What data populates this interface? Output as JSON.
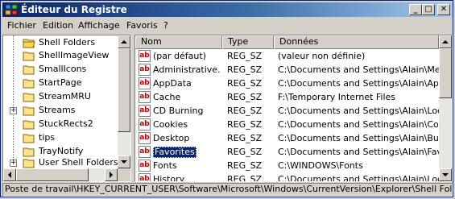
{
  "window": {
    "title": "Éditeur du Registre",
    "minimize_label": "_",
    "maximize_label": "□",
    "close_label": "✕"
  },
  "menu": [
    "Fichier",
    "Edition",
    "Affichage",
    "Favoris",
    "?"
  ],
  "tree": {
    "items": [
      {
        "label": "Shell Folders",
        "expander": ""
      },
      {
        "label": "ShellImageView",
        "expander": ""
      },
      {
        "label": "SmallIcons",
        "expander": ""
      },
      {
        "label": "StartPage",
        "expander": ""
      },
      {
        "label": "StreamMRU",
        "expander": ""
      },
      {
        "label": "Streams",
        "expander": "+"
      },
      {
        "label": "StuckRects2",
        "expander": ""
      },
      {
        "label": "tips",
        "expander": ""
      },
      {
        "label": "TrayNotify",
        "expander": ""
      },
      {
        "label": "User Shell Folders",
        "expander": "+"
      }
    ]
  },
  "list": {
    "columns": [
      "Nom",
      "Type",
      "Données"
    ],
    "rows": [
      {
        "name": "(par défaut)",
        "type": "REG_SZ",
        "data": "(valeur non définie)",
        "selected": false
      },
      {
        "name": "Administrative...",
        "type": "REG_SZ",
        "data": "C:\\Documents and Settings\\Alain\\Me...",
        "selected": false
      },
      {
        "name": "AppData",
        "type": "REG_SZ",
        "data": "C:\\Documents and Settings\\Alain\\App...",
        "selected": false
      },
      {
        "name": "Cache",
        "type": "REG_SZ",
        "data": "F:\\Temporary Internet Files",
        "selected": false
      },
      {
        "name": "CD Burning",
        "type": "REG_SZ",
        "data": "C:\\Documents and Settings\\Alain\\Loc...",
        "selected": false
      },
      {
        "name": "Cookies",
        "type": "REG_SZ",
        "data": "C:\\Documents and Settings\\Alain\\Coo...",
        "selected": false
      },
      {
        "name": "Desktop",
        "type": "REG_SZ",
        "data": "C:\\Documents and Settings\\Alain\\Bur...",
        "selected": false
      },
      {
        "name": "Favorites",
        "type": "REG_SZ",
        "data": "C:\\Documents and Settings\\Alain\\Fav...",
        "selected": true
      },
      {
        "name": "Fonts",
        "type": "REG_SZ",
        "data": "C:\\WINDOWS\\Fonts",
        "selected": false
      },
      {
        "name": "History",
        "type": "REG_SZ",
        "data": "C:\\Documents and Settings\\Alain\\Loc...",
        "selected": false
      }
    ],
    "icon_text": "ab"
  },
  "status": "Poste de travail\\HKEY_CURRENT_USER\\Software\\Microsoft\\Windows\\CurrentVersion\\Explorer\\Shell Folders"
}
